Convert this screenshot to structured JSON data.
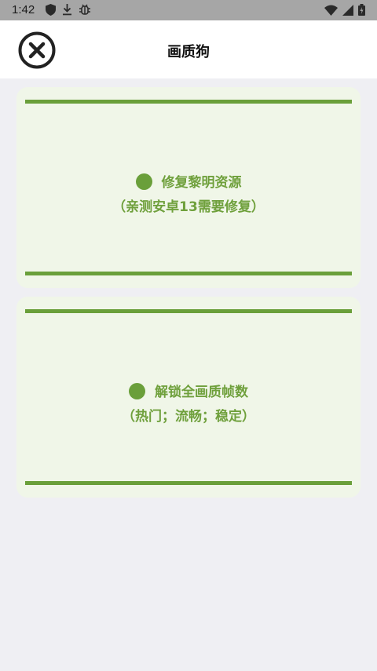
{
  "status_bar": {
    "time": "1:42",
    "icons_left": [
      "shield-icon",
      "download-icon",
      "bug-icon"
    ],
    "icons_right": [
      "wifi-icon",
      "signal-icon",
      "battery-icon"
    ]
  },
  "app_bar": {
    "title": "画质狗",
    "close_icon": "close-circle-icon"
  },
  "cards": [
    {
      "title": "修复黎明资源",
      "subtitle": "（亲测安卓13需要修复）"
    },
    {
      "title": "解锁全画质帧数",
      "subtitle": "（热门；流畅；稳定）"
    }
  ],
  "colors": {
    "accent": "#6a9f3a",
    "card_bg": "#f0f6e8",
    "page_bg": "#efeff3",
    "status_bar": "#a6a6a6"
  }
}
